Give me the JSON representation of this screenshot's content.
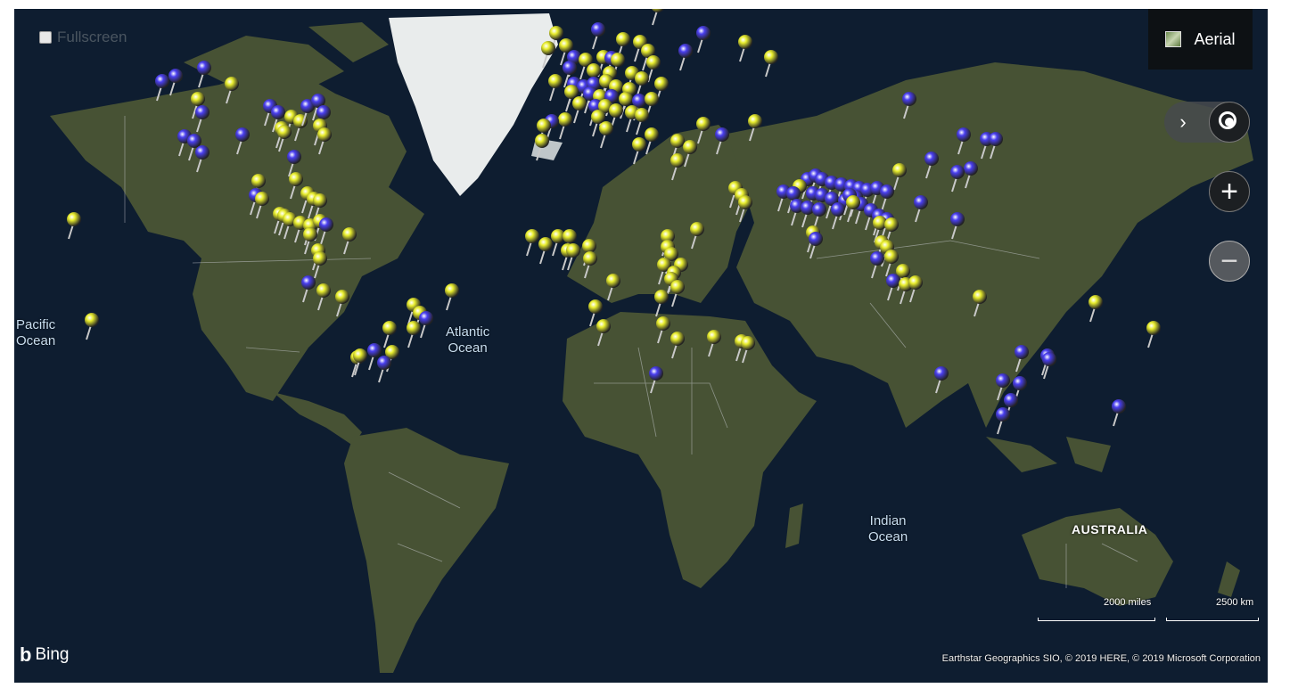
{
  "controls": {
    "fullscreen_label": "Fullscreen",
    "maptype_label": "Aerial",
    "zoom_in_symbol": "+",
    "zoom_out_symbol": "−",
    "expand_symbol": "›"
  },
  "labels": {
    "pacific": [
      "Pacific",
      "Ocean"
    ],
    "atlantic": [
      "Atlantic",
      "Ocean"
    ],
    "indian": [
      "Indian",
      "Ocean"
    ],
    "australia": "AUSTRALIA"
  },
  "scale": {
    "miles": "2000 miles",
    "km": "2500 km"
  },
  "branding": {
    "bing": "Bing",
    "attribution": "Earthstar Geographics SIO, © 2019 HERE, © 2019 Microsoft Corporation"
  },
  "colors": {
    "pin_yellow": "#e9ee2e",
    "pin_blue": "#4a3ff0",
    "ocean": "#0e1d30",
    "land": "#4b5535",
    "ice": "#e9ecec"
  },
  "icons": [
    "checkbox-icon",
    "aerial-icon",
    "chevron-right-icon",
    "locate-me-icon",
    "zoom-in-icon",
    "zoom-out-icon",
    "bing-logo-icon",
    "map-pin-icon"
  ],
  "pins": [
    {
      "lat": 66.5,
      "lon": 24.0,
      "c": "y"
    },
    {
      "lat": 65.5,
      "lon": 26.5,
      "c": "y"
    },
    {
      "lat": 64.0,
      "lon": 29.0,
      "c": "y"
    },
    {
      "lat": 60.5,
      "lon": 10.5,
      "c": "b"
    },
    {
      "lat": 60.0,
      "lon": -2.5,
      "c": "y"
    },
    {
      "lat": 57.5,
      "lon": -5.0,
      "c": "y"
    },
    {
      "lat": 58.0,
      "lon": 0.5,
      "c": "y"
    },
    {
      "lat": 59.0,
      "lon": 18.0,
      "c": "y"
    },
    {
      "lat": 58.5,
      "lon": 23.5,
      "c": "y"
    },
    {
      "lat": 57.0,
      "lon": 26.0,
      "c": "y"
    },
    {
      "lat": 56.0,
      "lon": 12.0,
      "c": "y"
    },
    {
      "lat": 56.0,
      "lon": 3.0,
      "c": "b"
    },
    {
      "lat": 55.5,
      "lon": 6.5,
      "c": "y"
    },
    {
      "lat": 55.8,
      "lon": 14.5,
      "c": "b"
    },
    {
      "lat": 55.5,
      "lon": 16.5,
      "c": "y"
    },
    {
      "lat": 54.0,
      "lon": 1.5,
      "c": "b"
    },
    {
      "lat": 53.5,
      "lon": 9.0,
      "c": "y"
    },
    {
      "lat": 53.0,
      "lon": 14.0,
      "c": "y"
    },
    {
      "lat": 53.0,
      "lon": 21.0,
      "c": "y"
    },
    {
      "lat": 55.0,
      "lon": 27.5,
      "c": "y"
    },
    {
      "lat": 57.0,
      "lon": 37.5,
      "c": "b"
    },
    {
      "lat": 58.5,
      "lon": 56.0,
      "c": "y"
    },
    {
      "lat": 56.0,
      "lon": 64.0,
      "c": "y"
    },
    {
      "lat": 51.5,
      "lon": -3.0,
      "c": "y"
    },
    {
      "lat": 51.0,
      "lon": 3.0,
      "c": "b"
    },
    {
      "lat": 50.5,
      "lon": 6.0,
      "c": "b"
    },
    {
      "lat": 51.0,
      "lon": 9.0,
      "c": "b"
    },
    {
      "lat": 51.5,
      "lon": 13.0,
      "c": "y"
    },
    {
      "lat": 50.5,
      "lon": 16.0,
      "c": "y"
    },
    {
      "lat": 50.0,
      "lon": 20.0,
      "c": "y"
    },
    {
      "lat": 52.0,
      "lon": 24.0,
      "c": "y"
    },
    {
      "lat": 51.0,
      "lon": 30.0,
      "c": "y"
    },
    {
      "lat": 49.5,
      "lon": 2.0,
      "c": "y"
    },
    {
      "lat": 49.0,
      "lon": 8.0,
      "c": "b"
    },
    {
      "lat": 48.5,
      "lon": 11.0,
      "c": "y"
    },
    {
      "lat": 48.5,
      "lon": 14.5,
      "c": "b"
    },
    {
      "lat": 48.0,
      "lon": 19.0,
      "c": "y"
    },
    {
      "lat": 47.5,
      "lon": 23.0,
      "c": "b"
    },
    {
      "lat": 48.0,
      "lon": 27.0,
      "c": "y"
    },
    {
      "lat": 47.0,
      "lon": 4.5,
      "c": "y"
    },
    {
      "lat": 46.5,
      "lon": 9.5,
      "c": "b"
    },
    {
      "lat": 46.5,
      "lon": 12.5,
      "c": "y"
    },
    {
      "lat": 45.5,
      "lon": 16.0,
      "c": "y"
    },
    {
      "lat": 45.0,
      "lon": 21.0,
      "c": "y"
    },
    {
      "lat": 44.5,
      "lon": 24.0,
      "c": "y"
    },
    {
      "lat": 43.5,
      "lon": 0.0,
      "c": "y"
    },
    {
      "lat": 43.0,
      "lon": -4.0,
      "c": "b"
    },
    {
      "lat": 44.0,
      "lon": 10.5,
      "c": "y"
    },
    {
      "lat": 42.0,
      "lon": -6.5,
      "c": "y"
    },
    {
      "lat": 41.5,
      "lon": 13.0,
      "c": "y"
    },
    {
      "lat": 40.0,
      "lon": 27.0,
      "c": "y"
    },
    {
      "lat": 38.5,
      "lon": -7.0,
      "c": "y"
    },
    {
      "lat": 37.5,
      "lon": 23.0,
      "c": "y"
    },
    {
      "lat": 38.5,
      "lon": 35.0,
      "c": "y"
    },
    {
      "lat": 37.0,
      "lon": 39.0,
      "c": "y"
    },
    {
      "lat": 33.5,
      "lon": 35.0,
      "c": "y"
    },
    {
      "lat": 42.5,
      "lon": 43.0,
      "c": "y"
    },
    {
      "lat": 43.0,
      "lon": 59.0,
      "c": "y"
    },
    {
      "lat": 40.0,
      "lon": 49.0,
      "c": "b"
    },
    {
      "lat": 60.0,
      "lon": 43.0,
      "c": "b"
    },
    {
      "lat": 48.0,
      "lon": 107.0,
      "c": "b"
    },
    {
      "lat": 40.0,
      "lon": 124.0,
      "c": "b"
    },
    {
      "lat": 39.0,
      "lon": 131.0,
      "c": "b"
    },
    {
      "lat": 39.0,
      "lon": 134.0,
      "c": "b"
    },
    {
      "lat": 34.0,
      "lon": 114.0,
      "c": "b"
    },
    {
      "lat": 31.0,
      "lon": 104.0,
      "c": "y"
    },
    {
      "lat": 31.5,
      "lon": 126.0,
      "c": "b"
    },
    {
      "lat": 30.5,
      "lon": 122.0,
      "c": "b"
    },
    {
      "lat": 28.5,
      "lon": 75.5,
      "c": "b"
    },
    {
      "lat": 29.5,
      "lon": 78.0,
      "c": "b"
    },
    {
      "lat": 28.5,
      "lon": 80.0,
      "c": "b"
    },
    {
      "lat": 27.5,
      "lon": 83.0,
      "c": "b"
    },
    {
      "lat": 27.0,
      "lon": 86.0,
      "c": "b"
    },
    {
      "lat": 26.5,
      "lon": 89.0,
      "c": "b"
    },
    {
      "lat": 26.0,
      "lon": 91.5,
      "c": "b"
    },
    {
      "lat": 25.5,
      "lon": 94.0,
      "c": "b"
    },
    {
      "lat": 26.0,
      "lon": 97.0,
      "c": "b"
    },
    {
      "lat": 25.0,
      "lon": 100.0,
      "c": "b"
    },
    {
      "lat": 26.5,
      "lon": 73.0,
      "c": "y"
    },
    {
      "lat": 25.0,
      "lon": 68.0,
      "c": "b"
    },
    {
      "lat": 24.5,
      "lon": 71.0,
      "c": "b"
    },
    {
      "lat": 24.5,
      "lon": 77.0,
      "c": "b"
    },
    {
      "lat": 24.0,
      "lon": 80.0,
      "c": "b"
    },
    {
      "lat": 23.0,
      "lon": 83.0,
      "c": "b"
    },
    {
      "lat": 22.5,
      "lon": 87.0,
      "c": "b"
    },
    {
      "lat": 23.5,
      "lon": 90.5,
      "c": "b"
    },
    {
      "lat": 21.5,
      "lon": 92.0,
      "c": "b"
    },
    {
      "lat": 21.0,
      "lon": 72.0,
      "c": "b"
    },
    {
      "lat": 20.5,
      "lon": 75.5,
      "c": "b"
    },
    {
      "lat": 20.0,
      "lon": 79.0,
      "c": "b"
    },
    {
      "lat": 20.0,
      "lon": 85.0,
      "c": "b"
    },
    {
      "lat": 19.5,
      "lon": 95.0,
      "c": "b"
    },
    {
      "lat": 18.0,
      "lon": 97.5,
      "c": "b"
    },
    {
      "lat": 17.0,
      "lon": 100.0,
      "c": "b"
    },
    {
      "lat": 16.0,
      "lon": 98.0,
      "c": "y"
    },
    {
      "lat": 15.5,
      "lon": 101.5,
      "c": "y"
    },
    {
      "lat": 13.0,
      "lon": 77.0,
      "c": "y"
    },
    {
      "lat": 11.0,
      "lon": 78.0,
      "c": "b"
    },
    {
      "lat": 10.0,
      "lon": 98.5,
      "c": "y"
    },
    {
      "lat": 8.5,
      "lon": 100.0,
      "c": "y"
    },
    {
      "lat": 22.0,
      "lon": 110.5,
      "c": "b"
    },
    {
      "lat": 17.0,
      "lon": 122.0,
      "c": "b"
    },
    {
      "lat": 5.5,
      "lon": 101.5,
      "c": "y"
    },
    {
      "lat": 5.0,
      "lon": 97.0,
      "c": "b"
    },
    {
      "lat": 1.0,
      "lon": 105.0,
      "c": "y"
    },
    {
      "lat": -2.0,
      "lon": 102.0,
      "c": "b"
    },
    {
      "lat": -3.0,
      "lon": 106.0,
      "c": "y"
    },
    {
      "lat": -2.5,
      "lon": 109.0,
      "c": "y"
    },
    {
      "lat": -7.0,
      "lon": 129.0,
      "c": "y"
    },
    {
      "lat": -8.5,
      "lon": 165.0,
      "c": "y"
    },
    {
      "lat": -16.5,
      "lon": 183.0,
      "c": "y"
    },
    {
      "lat": -23.5,
      "lon": 142.0,
      "c": "b"
    },
    {
      "lat": -24.5,
      "lon": 150.0,
      "c": "b"
    },
    {
      "lat": -25.5,
      "lon": 150.5,
      "c": "b"
    },
    {
      "lat": -29.5,
      "lon": 117.0,
      "c": "b"
    },
    {
      "lat": -31.5,
      "lon": 136.0,
      "c": "b"
    },
    {
      "lat": -32.0,
      "lon": 141.5,
      "c": "b"
    },
    {
      "lat": -36.5,
      "lon": 138.5,
      "c": "b"
    },
    {
      "lat": -40.0,
      "lon": 136.0,
      "c": "b"
    },
    {
      "lat": -38.0,
      "lon": 172.0,
      "c": "b"
    },
    {
      "lat": 26.0,
      "lon": 53.0,
      "c": "y"
    },
    {
      "lat": 24.0,
      "lon": 55.0,
      "c": "y"
    },
    {
      "lat": 22.0,
      "lon": 56.0,
      "c": "y"
    },
    {
      "lat": 14.0,
      "lon": 41.0,
      "c": "y"
    },
    {
      "lat": 12.0,
      "lon": 32.0,
      "c": "y"
    },
    {
      "lat": 8.5,
      "lon": 32.0,
      "c": "y"
    },
    {
      "lat": 6.5,
      "lon": 33.0,
      "c": "y"
    },
    {
      "lat": 3.0,
      "lon": 31.0,
      "c": "y"
    },
    {
      "lat": 3.0,
      "lon": 36.0,
      "c": "y"
    },
    {
      "lat": 0.5,
      "lon": 34.0,
      "c": "y"
    },
    {
      "lat": -1.5,
      "lon": 33.0,
      "c": "y"
    },
    {
      "lat": -4.0,
      "lon": 35.0,
      "c": "y"
    },
    {
      "lat": -7.0,
      "lon": 30.0,
      "c": "y"
    },
    {
      "lat": -10.0,
      "lon": 9.5,
      "c": "y"
    },
    {
      "lat": -15.0,
      "lon": 30.5,
      "c": "y"
    },
    {
      "lat": -16.0,
      "lon": 12.0,
      "c": "y"
    },
    {
      "lat": -19.5,
      "lon": 35.0,
      "c": "y"
    },
    {
      "lat": -19.0,
      "lon": 46.5,
      "c": "y"
    },
    {
      "lat": -20.5,
      "lon": 55.0,
      "c": "y"
    },
    {
      "lat": -21.0,
      "lon": 57.0,
      "c": "y"
    },
    {
      "lat": -29.5,
      "lon": 28.5,
      "c": "b"
    },
    {
      "lat": 12.0,
      "lon": -2.0,
      "c": "y"
    },
    {
      "lat": 12.0,
      "lon": 1.5,
      "c": "y"
    },
    {
      "lat": 9.5,
      "lon": -6.0,
      "c": "y"
    },
    {
      "lat": 7.5,
      "lon": 1.0,
      "c": "y"
    },
    {
      "lat": 7.5,
      "lon": 2.5,
      "c": "y"
    },
    {
      "lat": 9.0,
      "lon": 7.5,
      "c": "y"
    },
    {
      "lat": 12.0,
      "lon": -10.0,
      "c": "y"
    },
    {
      "lat": 51.5,
      "lon": -125.0,
      "c": "b"
    },
    {
      "lat": 52.5,
      "lon": -121.0,
      "c": "b"
    },
    {
      "lat": 54.0,
      "lon": -112.0,
      "c": "b"
    },
    {
      "lat": 51.0,
      "lon": -103.5,
      "c": "y"
    },
    {
      "lat": 48.0,
      "lon": -114.0,
      "c": "y"
    },
    {
      "lat": 45.0,
      "lon": -112.5,
      "c": "b"
    },
    {
      "lat": 39.5,
      "lon": -118.0,
      "c": "b"
    },
    {
      "lat": 38.5,
      "lon": -115.0,
      "c": "b"
    },
    {
      "lat": 35.5,
      "lon": -112.5,
      "c": "b"
    },
    {
      "lat": 40.0,
      "lon": -100.0,
      "c": "b"
    },
    {
      "lat": 46.5,
      "lon": -91.5,
      "c": "b"
    },
    {
      "lat": 45.0,
      "lon": -89.0,
      "c": "b"
    },
    {
      "lat": 44.0,
      "lon": -85.0,
      "c": "y"
    },
    {
      "lat": 43.0,
      "lon": -82.0,
      "c": "y"
    },
    {
      "lat": 46.5,
      "lon": -80.0,
      "c": "b"
    },
    {
      "lat": 47.5,
      "lon": -76.5,
      "c": "b"
    },
    {
      "lat": 45.0,
      "lon": -75.0,
      "c": "b"
    },
    {
      "lat": 42.0,
      "lon": -76.0,
      "c": "y"
    },
    {
      "lat": 40.0,
      "lon": -74.5,
      "c": "y"
    },
    {
      "lat": 41.5,
      "lon": -88.0,
      "c": "y"
    },
    {
      "lat": 40.5,
      "lon": -87.0,
      "c": "y"
    },
    {
      "lat": 34.5,
      "lon": -84.0,
      "c": "b"
    },
    {
      "lat": 28.0,
      "lon": -95.0,
      "c": "y"
    },
    {
      "lat": 28.5,
      "lon": -83.5,
      "c": "y"
    },
    {
      "lat": 24.0,
      "lon": -96.0,
      "c": "b"
    },
    {
      "lat": 23.0,
      "lon": -94.0,
      "c": "y"
    },
    {
      "lat": 24.5,
      "lon": -80.0,
      "c": "y"
    },
    {
      "lat": 23.0,
      "lon": -78.0,
      "c": "y"
    },
    {
      "lat": 22.5,
      "lon": -76.0,
      "c": "y"
    },
    {
      "lat": 18.5,
      "lon": -88.5,
      "c": "y"
    },
    {
      "lat": 18.0,
      "lon": -87.0,
      "c": "y"
    },
    {
      "lat": 17.0,
      "lon": -85.5,
      "c": "y"
    },
    {
      "lat": 16.0,
      "lon": -82.0,
      "c": "y"
    },
    {
      "lat": 15.0,
      "lon": -79.0,
      "c": "y"
    },
    {
      "lat": 16.5,
      "lon": -76.0,
      "c": "y"
    },
    {
      "lat": 15.5,
      "lon": -74.0,
      "c": "b"
    },
    {
      "lat": 12.5,
      "lon": -79.0,
      "c": "y"
    },
    {
      "lat": 12.5,
      "lon": -67.0,
      "c": "y"
    },
    {
      "lat": 7.5,
      "lon": -76.5,
      "c": "y"
    },
    {
      "lat": 5.0,
      "lon": -76.0,
      "c": "y"
    },
    {
      "lat": -2.5,
      "lon": -79.5,
      "c": "b"
    },
    {
      "lat": -5.0,
      "lon": -75.0,
      "c": "y"
    },
    {
      "lat": -7.0,
      "lon": -69.0,
      "c": "y"
    },
    {
      "lat": -5.0,
      "lon": -35.0,
      "c": "y"
    },
    {
      "lat": -9.5,
      "lon": -47.0,
      "c": "y"
    },
    {
      "lat": -12.0,
      "lon": -45.0,
      "c": "y"
    },
    {
      "lat": -13.5,
      "lon": -43.0,
      "c": "b"
    },
    {
      "lat": -16.5,
      "lon": -47.0,
      "c": "y"
    },
    {
      "lat": -16.5,
      "lon": -54.5,
      "c": "y"
    },
    {
      "lat": -23.0,
      "lon": -59.0,
      "c": "b"
    },
    {
      "lat": -23.5,
      "lon": -53.5,
      "c": "y"
    },
    {
      "lat": -25.0,
      "lon": -64.5,
      "c": "y"
    },
    {
      "lat": -24.5,
      "lon": -63.5,
      "c": "y"
    },
    {
      "lat": -26.5,
      "lon": -56.0,
      "c": "b"
    },
    {
      "lat": 17.0,
      "lon": -152.5,
      "c": "y"
    },
    {
      "lat": -14.0,
      "lon": -147.0,
      "c": "y"
    },
    {
      "lat": 5.0,
      "lon": 8.0,
      "c": "y"
    },
    {
      "lat": -2.0,
      "lon": 15.0,
      "c": "y"
    },
    {
      "lat": 24.0,
      "lon": 88.5,
      "c": "b"
    },
    {
      "lat": 22.0,
      "lon": 89.5,
      "c": "y"
    }
  ]
}
